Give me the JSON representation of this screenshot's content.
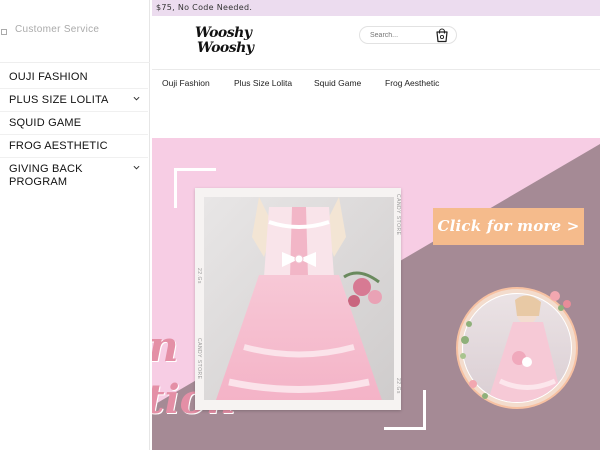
{
  "announcement": {
    "text": "$75, No Code Needed."
  },
  "drawer": {
    "customer_service_label": "Customer Service",
    "items": [
      {
        "label": "OUJI FASHION",
        "has_submenu": false
      },
      {
        "label": "PLUS SIZE LOLITA",
        "has_submenu": true
      },
      {
        "label": "SQUID GAME",
        "has_submenu": false
      },
      {
        "label": "FROG AESTHETIC",
        "has_submenu": false
      },
      {
        "label": "GIVING BACK PROGRAM",
        "has_submenu": true
      }
    ]
  },
  "header": {
    "logo_line1": "Wooshy",
    "logo_line2": "Wooshy",
    "search_placeholder": "Search..."
  },
  "nav": {
    "links": [
      "Ouji Fashion",
      "Plus Size Lolita",
      "Squid Game",
      "Frog Aesthetic"
    ]
  },
  "hero": {
    "cta_label": "Click for more >",
    "text_line1": "n",
    "text_line2": "tion",
    "frame_caption": "CANDY STORE",
    "frame_number": "22.Gs"
  },
  "colors": {
    "announcement_bg": "#ecdcef",
    "hero_pink": "#f7cde4",
    "hero_mauve": "#a58a95",
    "cta": "#f5bb8c",
    "hero_text": "#e48fa6"
  }
}
